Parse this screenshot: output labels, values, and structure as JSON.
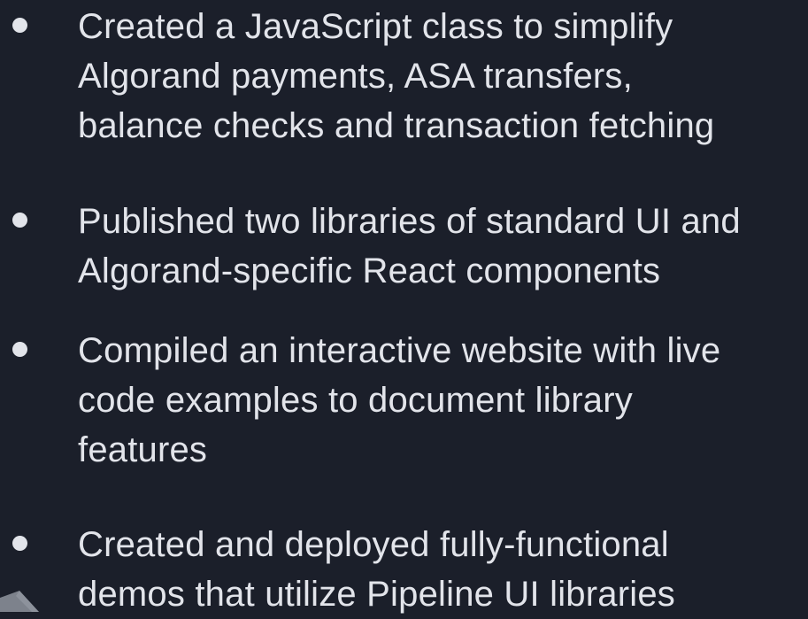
{
  "bullets": [
    {
      "lines": [
        "Created a JavaScript class to simplify",
        "Algorand payments, ASA transfers,",
        "balance checks and transaction fetching"
      ]
    },
    {
      "lines": [
        "Published two libraries of standard UI and",
        "Algorand-specific React components"
      ]
    },
    {
      "lines": [
        "Compiled an interactive website with live",
        "code examples to document library",
        "features"
      ]
    },
    {
      "lines": [
        "Created and deployed fully-functional",
        "demos that utilize Pipeline UI libraries"
      ]
    }
  ],
  "colors": {
    "background": "#1b1f2a",
    "text": "#e2e4ea",
    "bullet": "#e2e4ea",
    "corner_shape": "#7d828c"
  }
}
